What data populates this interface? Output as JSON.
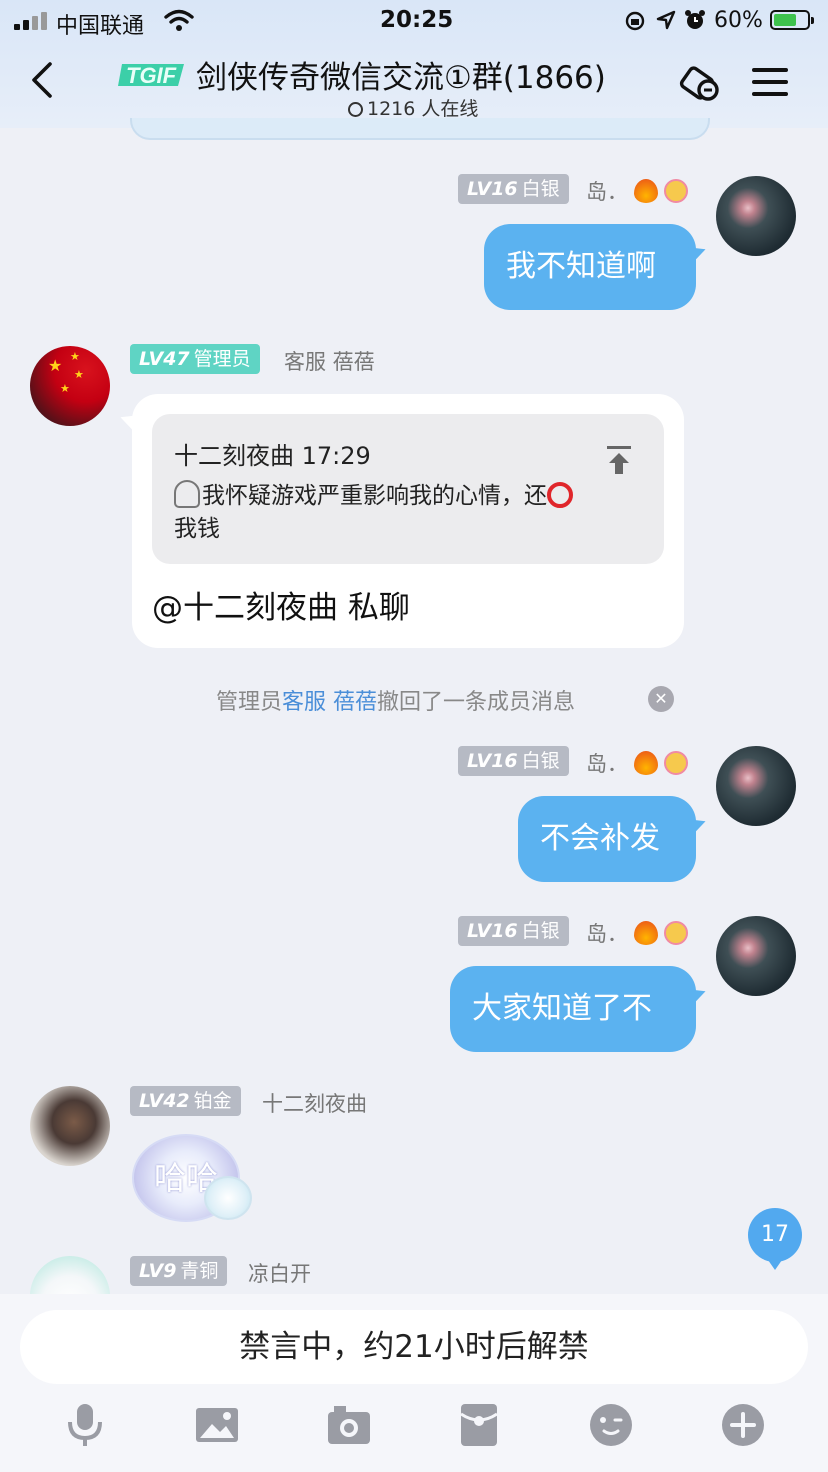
{
  "status_bar": {
    "carrier": "中国联通",
    "time": "20:25",
    "battery_percent": "60%"
  },
  "header": {
    "logo_text": "TGIF",
    "title": "剑侠传奇微信交流①群(1866)",
    "online_text": "1216 人在线"
  },
  "messages": [
    {
      "side": "right",
      "level": "LV16",
      "rank": "白银",
      "nickname": "岛．",
      "text": "我不知道啊"
    },
    {
      "side": "left",
      "level": "LV47",
      "rank": "管理员",
      "nickname": "客服 蓓蓓",
      "quote": {
        "author_time": "十二刻夜曲 17:29",
        "text_before": "我怀疑游戏严重影响我的心情，还",
        "text_after": "我钱"
      },
      "text": "@十二刻夜曲  私聊"
    },
    {
      "side": "right",
      "level": "LV16",
      "rank": "白银",
      "nickname": "岛．",
      "text": "不会补发"
    },
    {
      "side": "right",
      "level": "LV16",
      "rank": "白银",
      "nickname": "岛．",
      "text": "大家知道了不"
    },
    {
      "side": "left",
      "level": "LV42",
      "rank": "铂金",
      "nickname": "十二刻夜曲",
      "text": "哈哈"
    },
    {
      "side": "left",
      "level": "LV9",
      "rank": "青铜",
      "nickname": "凉白开"
    }
  ],
  "system_notice": {
    "prefix": "管理员",
    "admin_name": "客服 蓓蓓",
    "suffix": "撤回了一条成员消息"
  },
  "unread_count": "17",
  "input": {
    "muted_text": "禁言中，约21小时后解禁"
  },
  "toolbar": [
    "microphone-icon",
    "image-icon",
    "camera-icon",
    "red-packet-icon",
    "emoji-icon",
    "plus-icon"
  ],
  "colors": {
    "bubble_blue": "#5bb2f0",
    "badge_gray": "#b6bac4",
    "badge_teal": "#5fd4c4",
    "link_blue": "#4a8ed8"
  }
}
